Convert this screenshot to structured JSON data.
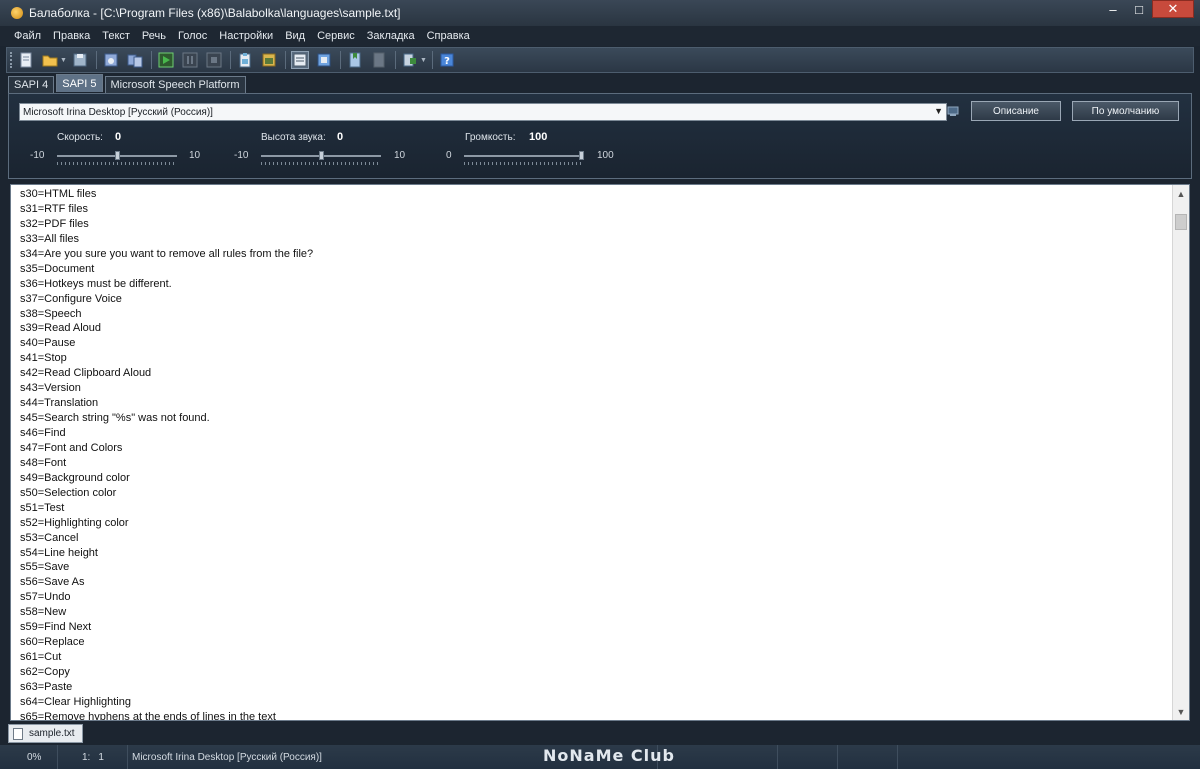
{
  "window": {
    "title": "Балаболка - [C:\\Program Files (x86)\\Balabolka\\languages\\sample.txt]",
    "minimize": "‒",
    "maximize": "□",
    "close": "✕"
  },
  "menu": [
    "Файл",
    "Правка",
    "Текст",
    "Речь",
    "Голос",
    "Настройки",
    "Вид",
    "Сервис",
    "Закладка",
    "Справка"
  ],
  "toolbar": {
    "buttons": [
      {
        "name": "new-icon",
        "color": "#e8eef5"
      },
      {
        "name": "open-folder-icon",
        "color": "#f2c14e"
      },
      {
        "name": "save-icon",
        "color": "#9fb4c9"
      },
      {
        "name": "save-audio-icon",
        "color": "#8fa9d8"
      },
      {
        "name": "convert-icon",
        "color": "#8fa9d8"
      },
      {
        "name": "play-icon",
        "color": "#48b84c"
      },
      {
        "name": "pause-icon",
        "color": "#6b7785"
      },
      {
        "name": "stop-icon",
        "color": "#6b7785"
      },
      {
        "name": "read-clipboard-icon",
        "color": "#6fb0d8"
      },
      {
        "name": "read-file-icon",
        "color": "#d9b54e"
      },
      {
        "name": "text-view-icon",
        "color": "#e6ecf3"
      },
      {
        "name": "dictionary-icon",
        "color": "#6fa3e0"
      },
      {
        "name": "bookmark-icon",
        "color": "#a9c7e6"
      },
      {
        "name": "bookmark-disabled-icon",
        "color": "#6b7785"
      },
      {
        "name": "settings-icon",
        "color": "#c7d3e0"
      },
      {
        "name": "help-icon",
        "color": "#4a86d8"
      }
    ]
  },
  "tabs": [
    {
      "label": "SAPI 4",
      "active": false
    },
    {
      "label": "SAPI 5",
      "active": true
    },
    {
      "label": "Microsoft Speech Platform",
      "active": false
    }
  ],
  "voice": {
    "selected": "Microsoft Irina Desktop [Русский (Россия)]",
    "description_button": "Описание",
    "default_button": "По умолчанию"
  },
  "params": [
    {
      "label": "Скорость:",
      "value": "0",
      "min": "-10",
      "max": "10",
      "fraction": 0.5
    },
    {
      "label": "Высота звука:",
      "value": "0",
      "min": "-10",
      "max": "10",
      "fraction": 0.5
    },
    {
      "label": "Громкость:",
      "value": "100",
      "min": "0",
      "max": "100",
      "fraction": 1.0
    }
  ],
  "editor_lines": [
    "s30=HTML files",
    "s31=RTF files",
    "s32=PDF files",
    "s33=All files",
    "s34=Are you sure you want to remove all rules from the file?",
    "s35=Document",
    "s36=Hotkeys must be different.",
    "s37=Configure Voice",
    "s38=Speech",
    "s39=Read Aloud",
    "s40=Pause",
    "s41=Stop",
    "s42=Read Clipboard Aloud",
    "s43=Version",
    "s44=Translation",
    "s45=Search string \"%s\" was not found.",
    "s46=Find",
    "s47=Font and Colors",
    "s48=Font",
    "s49=Background color",
    "s50=Selection color",
    "s51=Test",
    "s52=Highlighting color",
    "s53=Cancel",
    "s54=Line height",
    "s55=Save",
    "s56=Save As",
    "s57=Undo",
    "s58=New",
    "s59=Find Next",
    "s60=Replace",
    "s61=Cut",
    "s62=Copy",
    "s63=Paste",
    "s64=Clear Highlighting",
    "s65=Remove hyphens at the ends of lines in the text"
  ],
  "doc_tab": "sample.txt",
  "status": {
    "percent": "0%",
    "line": "1:",
    "col": "1",
    "voice": "Microsoft Irina Desktop [Русский (Россия)]",
    "brand": "NoNaMe Club"
  }
}
